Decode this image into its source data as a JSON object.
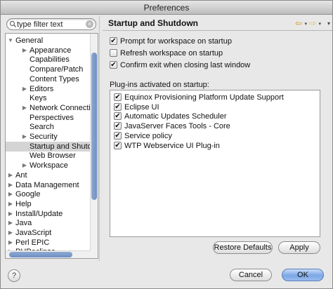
{
  "window": {
    "title": "Preferences"
  },
  "filter": {
    "placeholder": "type filter text",
    "value": "type filter text"
  },
  "tree": {
    "items": [
      {
        "label": "General",
        "level": 0,
        "expanded": true,
        "has_children": true,
        "selected": false
      },
      {
        "label": "Appearance",
        "level": 1,
        "expanded": false,
        "has_children": true,
        "selected": false
      },
      {
        "label": "Capabilities",
        "level": 1,
        "expanded": false,
        "has_children": false,
        "selected": false
      },
      {
        "label": "Compare/Patch",
        "level": 1,
        "expanded": false,
        "has_children": false,
        "selected": false
      },
      {
        "label": "Content Types",
        "level": 1,
        "expanded": false,
        "has_children": false,
        "selected": false
      },
      {
        "label": "Editors",
        "level": 1,
        "expanded": false,
        "has_children": true,
        "selected": false
      },
      {
        "label": "Keys",
        "level": 1,
        "expanded": false,
        "has_children": false,
        "selected": false
      },
      {
        "label": "Network Connections",
        "level": 1,
        "expanded": false,
        "has_children": true,
        "selected": false
      },
      {
        "label": "Perspectives",
        "level": 1,
        "expanded": false,
        "has_children": false,
        "selected": false
      },
      {
        "label": "Search",
        "level": 1,
        "expanded": false,
        "has_children": false,
        "selected": false
      },
      {
        "label": "Security",
        "level": 1,
        "expanded": false,
        "has_children": true,
        "selected": false
      },
      {
        "label": "Startup and Shutdown",
        "level": 1,
        "expanded": false,
        "has_children": false,
        "selected": true
      },
      {
        "label": "Web Browser",
        "level": 1,
        "expanded": false,
        "has_children": false,
        "selected": false
      },
      {
        "label": "Workspace",
        "level": 1,
        "expanded": false,
        "has_children": true,
        "selected": false
      },
      {
        "label": "Ant",
        "level": 0,
        "expanded": false,
        "has_children": true,
        "selected": false
      },
      {
        "label": "Data Management",
        "level": 0,
        "expanded": false,
        "has_children": true,
        "selected": false
      },
      {
        "label": "Google",
        "level": 0,
        "expanded": false,
        "has_children": true,
        "selected": false
      },
      {
        "label": "Help",
        "level": 0,
        "expanded": false,
        "has_children": true,
        "selected": false
      },
      {
        "label": "Install/Update",
        "level": 0,
        "expanded": false,
        "has_children": true,
        "selected": false
      },
      {
        "label": "Java",
        "level": 0,
        "expanded": false,
        "has_children": true,
        "selected": false
      },
      {
        "label": "JavaScript",
        "level": 0,
        "expanded": false,
        "has_children": true,
        "selected": false
      },
      {
        "label": "Perl EPIC",
        "level": 0,
        "expanded": false,
        "has_children": true,
        "selected": false
      },
      {
        "label": "PHPeclipse",
        "level": 0,
        "expanded": false,
        "has_children": true,
        "selected": false
      }
    ]
  },
  "page": {
    "title": "Startup and Shutdown",
    "nav": {
      "back": "⇦",
      "forward": "⇨",
      "dropdown": "▾",
      "menu": "▾"
    },
    "options": [
      {
        "label": "Prompt for workspace on startup",
        "checked": true
      },
      {
        "label": "Refresh workspace on startup",
        "checked": false
      },
      {
        "label": "Confirm exit when closing last window",
        "checked": true
      }
    ],
    "plugins_label": "Plug-ins activated on startup:",
    "plugins": [
      {
        "label": "Equinox Provisioning Platform Update Support",
        "checked": true
      },
      {
        "label": "Eclipse UI",
        "checked": true
      },
      {
        "label": "Automatic Updates Scheduler",
        "checked": true
      },
      {
        "label": "JavaServer Faces Tools - Core",
        "checked": true
      },
      {
        "label": "Service policy",
        "checked": true
      },
      {
        "label": "WTP Webservice UI Plug-in",
        "checked": true
      }
    ],
    "restore_defaults_label": "Restore Defaults",
    "apply_label": "Apply"
  },
  "footer": {
    "help": "?",
    "cancel_label": "Cancel",
    "ok_label": "OK"
  },
  "icons": {
    "check": "✔",
    "clear": "×",
    "expanded": "▼",
    "collapsed": "▶"
  },
  "colors": {
    "selection": "#d4d4d4",
    "scrollbar_thumb": "#7c9bcb",
    "primary_button": "#7aa7e6"
  }
}
